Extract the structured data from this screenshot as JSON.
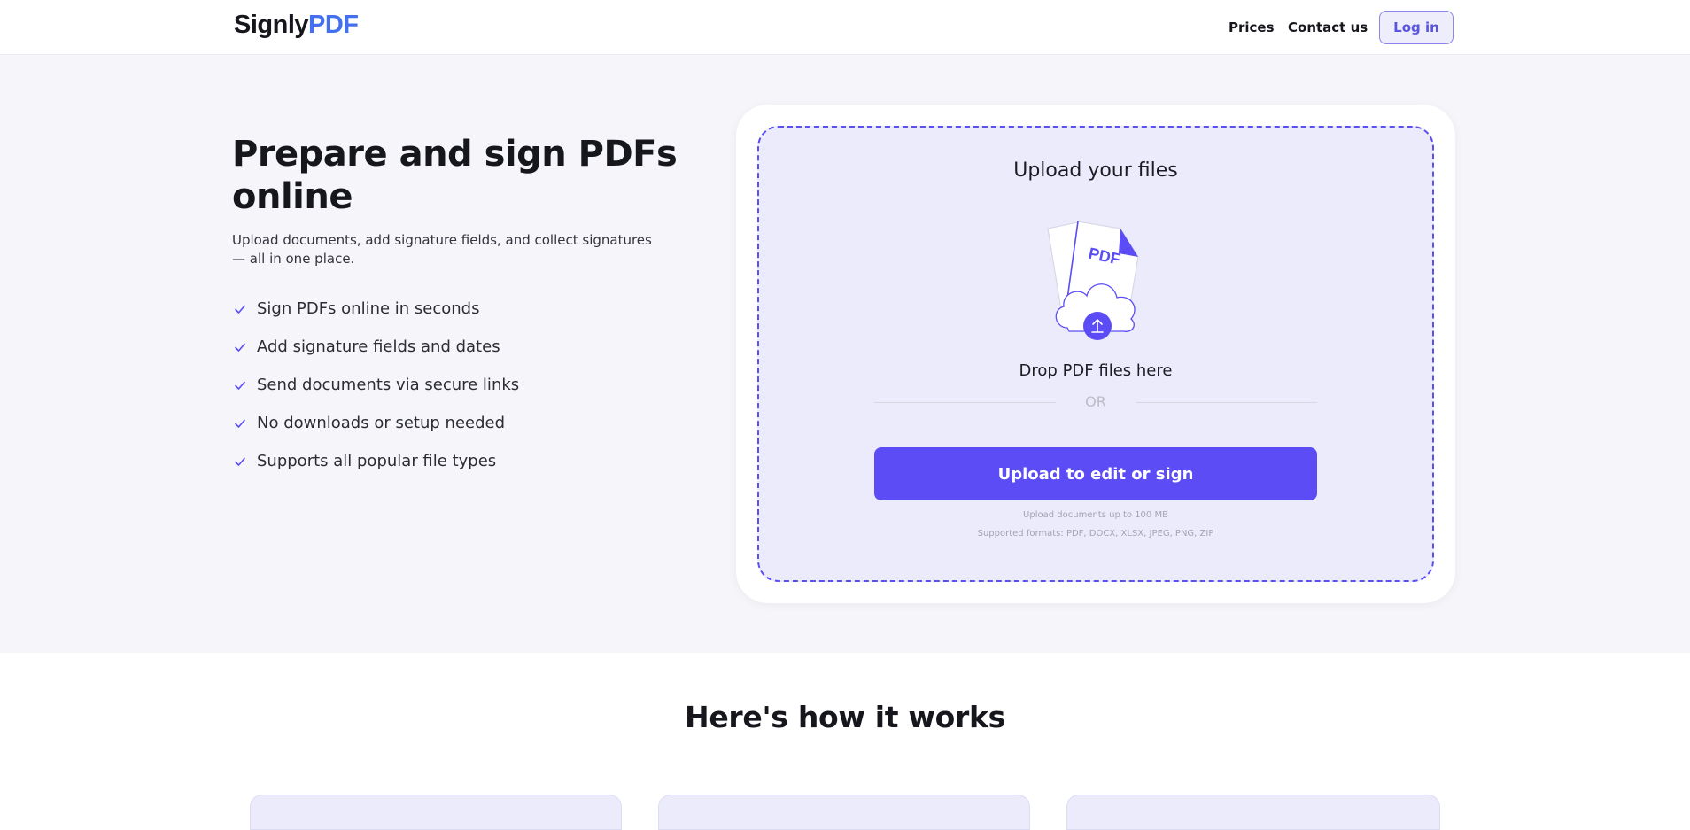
{
  "header": {
    "logo_part1": "Signly",
    "logo_part2": "PDF",
    "nav": {
      "prices": "Prices",
      "contact": "Contact us",
      "login": "Log in"
    }
  },
  "hero": {
    "title": "Prepare and sign PDFs online",
    "subtitle": "Upload documents, add signature fields, and collect signatures — all in one place.",
    "features": [
      "Sign PDFs online in seconds",
      "Add signature fields and dates",
      "Send documents via secure links",
      "No downloads or setup needed",
      "Supports all popular file types"
    ]
  },
  "upload": {
    "title": "Upload your files",
    "illustration_label": "PDF",
    "drop_text": "Drop PDF files here",
    "or": "OR",
    "button": "Upload to edit or sign",
    "limit": "Upload documents up to 100 MB",
    "formats": "Supported formats: PDF, DOCX, XLSX, JPEG, PNG, ZIP"
  },
  "how": {
    "title": "Here's how it works"
  },
  "colors": {
    "accent": "#5b4cf5",
    "brand_blue": "#4470f0",
    "hero_bg": "#f6f6fa",
    "dropzone_bg": "#ebebfc"
  }
}
